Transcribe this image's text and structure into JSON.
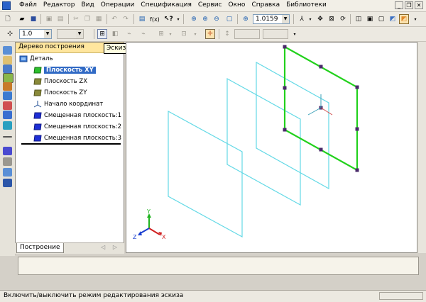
{
  "menu": [
    "Файл",
    "Редактор",
    "Вид",
    "Операции",
    "Спецификация",
    "Сервис",
    "Окно",
    "Справка",
    "Библиотеки"
  ],
  "toolbar1": {
    "zoom_value": "1.0159"
  },
  "toolbar2": {
    "step_value": "1.0"
  },
  "tooltip": "Эскиз",
  "tree": {
    "title": "Дерево построения",
    "root": "Деталь",
    "items": [
      "Плоскость XY",
      "Плоскость ZX",
      "Плоскость ZY",
      "Начало координат",
      "Смещенная плоскость:1",
      "Смещенная плоскость:2",
      "Смещенная плоскость:3"
    ],
    "tab": "Построение",
    "tab_arrows": "◁ ▷"
  },
  "axes": {
    "x": "X",
    "y": "Y",
    "z": "Z"
  },
  "status": "Включить/выключить режим редактирования эскиза",
  "colors": {
    "plane": "#63d9e6",
    "selected_plane": "#22d11c",
    "tree_header": "#ffe69e",
    "selection": "#316ac5"
  }
}
